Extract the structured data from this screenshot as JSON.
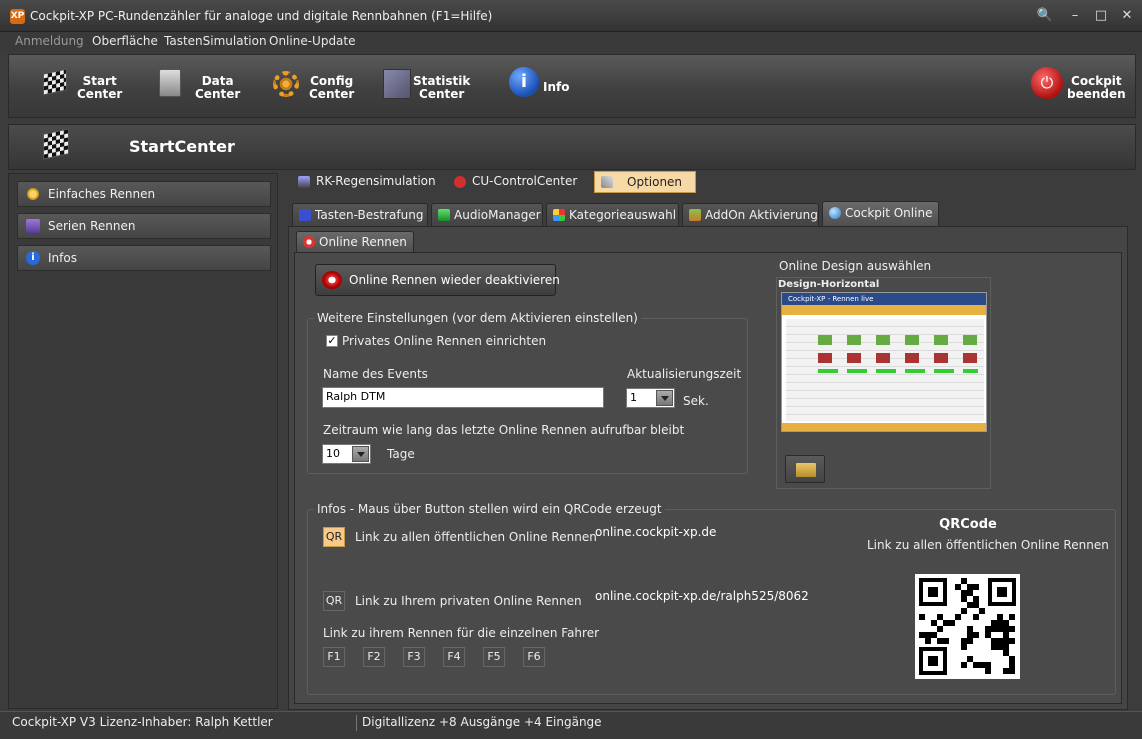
{
  "window": {
    "title": "Cockpit-XP PC-Rundenzähler für analoge und digitale Rennbahnen (F1=Hilfe)",
    "app_icon_text": "XP"
  },
  "menu": [
    "Anmeldung",
    "Oberfläche",
    "TastenSimulation",
    "Online-Update"
  ],
  "toolbar": {
    "start": [
      "Start",
      "Center"
    ],
    "data": [
      "Data",
      "Center"
    ],
    "config": [
      "Config",
      "Center"
    ],
    "statistik": [
      "Statistik",
      "Center"
    ],
    "info": "Info",
    "exit": [
      "Cockpit",
      "beenden"
    ]
  },
  "startcenter_title": "StartCenter",
  "sidebar": [
    "Einfaches Rennen",
    "Serien Rennen",
    "Infos"
  ],
  "top_tabs": [
    "RK-Regensimulation",
    "CU-ControlCenter",
    "Optionen"
  ],
  "sub_tabs": [
    "Tasten-Bestrafung",
    "AudioManager",
    "Kategorieauswahl",
    "AddOn Aktivierung",
    "Cockpit Online"
  ],
  "inner_tab": "Online Rennen",
  "online": {
    "deactivate_button": "Online Rennen wieder deaktivieren",
    "settings_title": "Weitere Einstellungen (vor dem Aktivieren einstellen)",
    "private_checkbox": "Privates Online Rennen einrichten",
    "event_name_label": "Name des Events",
    "event_name_value": "Ralph DTM",
    "update_label": "Aktualisierungszeit",
    "update_value": "1",
    "update_unit": "Sek.",
    "period_label": "Zeitraum wie lang das letzte Online Rennen aufrufbar bleibt",
    "period_value": "10",
    "period_unit": "Tage",
    "design_title": "Online Design auswählen",
    "design_name": "Design-Horizontal",
    "preview_title": "Cockpit-XP - Rennen live"
  },
  "infos": {
    "title": "Infos - Maus über Button stellen wird ein QRCode erzeugt",
    "qr_label": "QR",
    "public_link_label": "Link zu allen öffentlichen Online Rennen",
    "public_url": "online.cockpit-xp.de",
    "private_link_label": "Link zu Ihrem privaten Online Rennen",
    "private_url": "online.cockpit-xp.de/ralph525/8062",
    "driver_links_label": "Link zu ihrem Rennen für die einzelnen Fahrer",
    "driver_buttons": [
      "F1",
      "F2",
      "F3",
      "F4",
      "F5",
      "F6"
    ],
    "qrcode_title": "QRCode",
    "qrcode_subtitle": "Link zu allen öffentlichen Online Rennen"
  },
  "status": {
    "license": "Cockpit-XP V3 Lizenz-Inhaber: Ralph Kettler",
    "mode": "Digitallizenz  +8 Ausgänge +4 Eingänge"
  },
  "colors": {
    "accent": "#f5c98a",
    "highlight_tab": "#f7d9a6"
  }
}
